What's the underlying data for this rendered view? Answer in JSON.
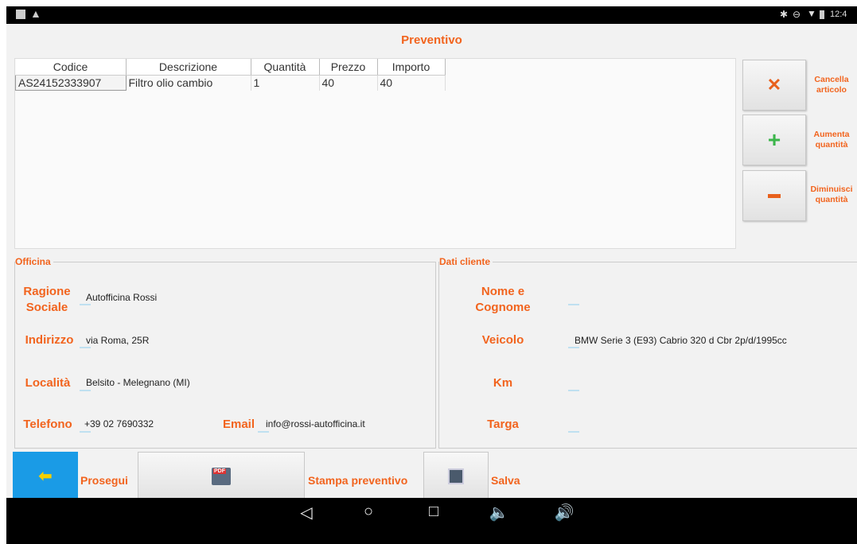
{
  "status_bar": {
    "time": "12:4"
  },
  "app": {
    "title": "Preventivo"
  },
  "table": {
    "headers": [
      "Codice",
      "Descrizione",
      "Quantità",
      "Prezzo",
      "Importo"
    ],
    "rows": [
      [
        "AS24152333907",
        "Filtro olio cambio",
        "1",
        "40",
        "40"
      ]
    ]
  },
  "side_buttons": {
    "remove": "Cancella articolo",
    "increase": "Aumenta quantità",
    "decrease": "Diminuisci quantità"
  },
  "officina": {
    "title": "Officina",
    "ragione_label": "Ragione Sociale",
    "ragione_value": "Autofficina Rossi",
    "indirizzo_label": "Indirizzo",
    "indirizzo_value": "via Roma, 25R",
    "localita_label": "Località",
    "localita_value": "Belsito - Melegnano (MI)",
    "telefono_label": "Telefono",
    "telefono_value": "+39 02 7690332",
    "email_label": "Email",
    "email_value": "info@rossi-autofficina.it"
  },
  "cliente": {
    "title": "Dati cliente",
    "nome_label": "Nome e Cognome",
    "nome_value": "",
    "veicolo_label": "Veicolo",
    "veicolo_value": "BMW Serie 3 (E93) Cabrio 320 d Cbr 2p/d/1995cc",
    "km_label": "Km",
    "km_value": "",
    "targa_label": "Targa",
    "targa_value": ""
  },
  "bottom": {
    "prosegui": "Prosegui",
    "stampa": "Stampa preventivo",
    "salva": "Salva",
    "pdf_icon_text": "PDF"
  },
  "colors": {
    "accent": "#f2641e",
    "back_button": "#1a9be6"
  }
}
